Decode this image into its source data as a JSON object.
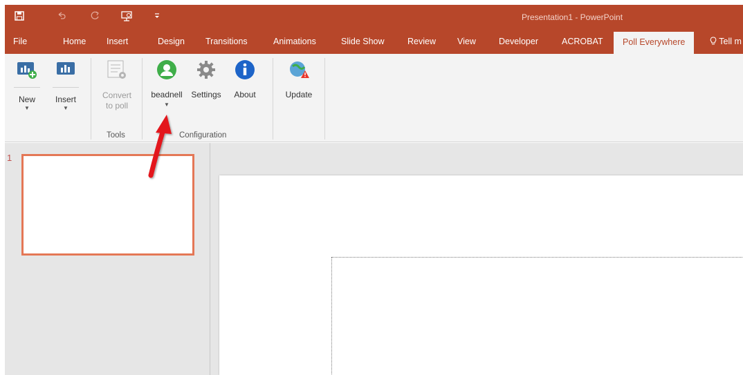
{
  "quick_access": {
    "save_icon": "save-icon",
    "undo_icon": "undo-icon",
    "redo_icon": "redo-icon",
    "present_icon": "present-from-start-icon",
    "customize_icon": "customize-toolbar-icon"
  },
  "window": {
    "title": "Presentation1 - PowerPoint"
  },
  "tabs": [
    "File",
    "Home",
    "Insert",
    "Design",
    "Transitions",
    "Animations",
    "Slide Show",
    "Review",
    "View",
    "Developer",
    "ACROBAT",
    "Poll Everywhere"
  ],
  "active_tab": "Poll Everywhere",
  "tell_me": "Tell m",
  "ribbon": {
    "new": {
      "label": "New",
      "icon": "new-poll-icon"
    },
    "insert": {
      "label": "Insert",
      "icon": "insert-poll-icon"
    },
    "convert": {
      "label_line1": "Convert",
      "label_line2": "to poll",
      "icon": "convert-to-poll-icon"
    },
    "tools_group": "Tools",
    "account": {
      "label": "beadnell",
      "icon": "user-account-icon"
    },
    "settings": {
      "label": "Settings",
      "icon": "gear-icon"
    },
    "about": {
      "label": "About",
      "icon": "info-icon"
    },
    "configuration_group": "Configuration",
    "update": {
      "label": "Update",
      "icon": "update-icon"
    }
  },
  "slides": {
    "thumbnail_number": "1"
  },
  "colors": {
    "accent": "#b7472a",
    "ribbon_bg": "#f3f3f3",
    "thumbnail_border": "#e47756",
    "annotation_arrow": "#e3141b"
  }
}
